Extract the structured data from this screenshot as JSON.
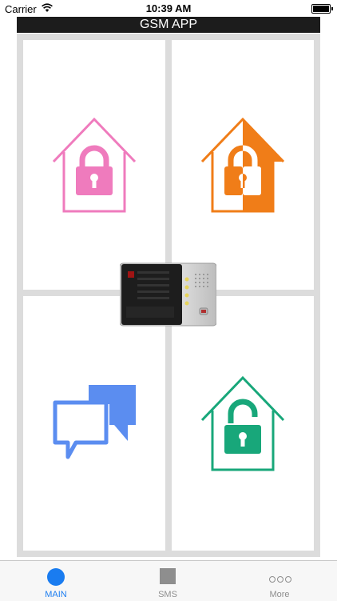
{
  "status_bar": {
    "carrier": "Carrier",
    "time": "10:39 AM"
  },
  "header": {
    "title": "GSM APP"
  },
  "tiles": {
    "arm": {
      "icon": "house-locked-icon",
      "color": "#ef7bbd"
    },
    "partial_arm": {
      "icon": "house-half-locked-icon",
      "color": "#f07d18"
    },
    "sms_messages": {
      "icon": "chat-bubbles-icon",
      "color": "#5b8df0"
    },
    "disarm": {
      "icon": "house-unlocked-icon",
      "color": "#18a77a"
    }
  },
  "center": {
    "icon": "gsm-alarm-device"
  },
  "tab_bar": {
    "tabs": [
      {
        "label": "MAIN",
        "icon": "main-dot-icon",
        "color": "#1a7cf0"
      },
      {
        "label": "SMS",
        "icon": "sms-square-icon",
        "color": "#8e8e8e"
      },
      {
        "label": "More",
        "icon": "more-dots-icon",
        "color": "#8e8e8e"
      }
    ]
  }
}
